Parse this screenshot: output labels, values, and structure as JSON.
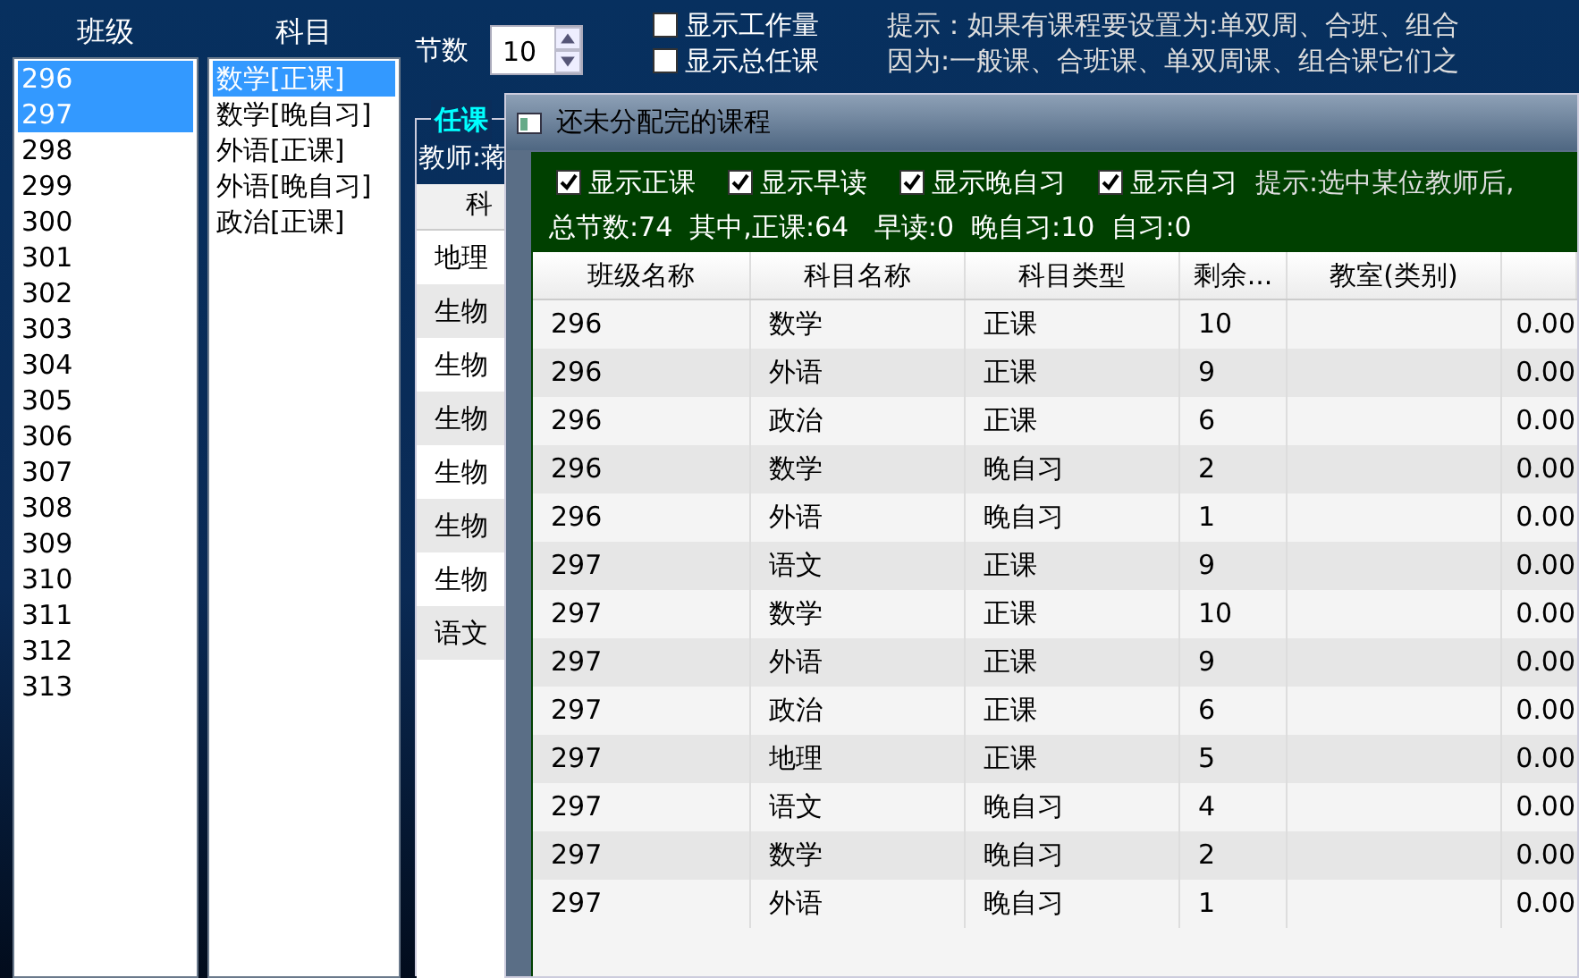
{
  "class_list": {
    "label": "班级",
    "items": [
      {
        "text": "296",
        "selected": true
      },
      {
        "text": "297",
        "selected": true
      },
      {
        "text": "298",
        "selected": false
      },
      {
        "text": "299",
        "selected": false
      },
      {
        "text": "300",
        "selected": false
      },
      {
        "text": "301",
        "selected": false
      },
      {
        "text": "302",
        "selected": false
      },
      {
        "text": "303",
        "selected": false
      },
      {
        "text": "304",
        "selected": false
      },
      {
        "text": "305",
        "selected": false
      },
      {
        "text": "306",
        "selected": false
      },
      {
        "text": "307",
        "selected": false
      },
      {
        "text": "308",
        "selected": false
      },
      {
        "text": "309",
        "selected": false
      },
      {
        "text": "310",
        "selected": false
      },
      {
        "text": "311",
        "selected": false
      },
      {
        "text": "312",
        "selected": false
      },
      {
        "text": "313",
        "selected": false
      }
    ]
  },
  "subject_list": {
    "label": "科目",
    "items": [
      {
        "text": "数学[正课]",
        "selected": true
      },
      {
        "text": "数学[晚自习]",
        "selected": false
      },
      {
        "text": "外语[正课]",
        "selected": false
      },
      {
        "text": "外语[晚自习]",
        "selected": false
      },
      {
        "text": "政治[正课]",
        "selected": false
      }
    ]
  },
  "period_count": {
    "label": "节数",
    "value": "10"
  },
  "options": [
    {
      "label": "显示工作量",
      "checked": false
    },
    {
      "label": "显示总任课",
      "checked": false
    }
  ],
  "hint_lines": [
    "提示：如果有课程要设置为:单双周、合班、组合",
    "因为:一般课、合班课、单双周课、组合课它们之"
  ],
  "assignment_panel": {
    "legend": "任课",
    "teacher": "教师:蒋",
    "columns": [
      "科"
    ],
    "rows": [
      "地理",
      "生物",
      "生物",
      "生物",
      "生物",
      "生物",
      "生物",
      "语文"
    ]
  },
  "dialog": {
    "title": "还未分配完的课程",
    "filters": [
      {
        "label": "显示正课",
        "checked": true
      },
      {
        "label": "显示早读",
        "checked": true
      },
      {
        "label": "显示晚自习",
        "checked": true
      },
      {
        "label": "显示自习",
        "checked": true
      }
    ],
    "hint": "提示:选中某位教师后,",
    "summary": "总节数:74  其中,正课:64   早读:0  晚自习:10  自习:0",
    "table": {
      "columns": [
        "班级名称",
        "科目名称",
        "科目类型",
        "剩余...",
        "教室(类别)"
      ],
      "rows": [
        {
          "class": "296",
          "subject": "数学",
          "type": "正课",
          "remaining": "10",
          "column_6": "0.00"
        },
        {
          "class": "296",
          "subject": "外语",
          "type": "正课",
          "remaining": "9",
          "column_6": "0.00"
        },
        {
          "class": "296",
          "subject": "政治",
          "type": "正课",
          "remaining": "6",
          "column_6": "0.00"
        },
        {
          "class": "296",
          "subject": "数学",
          "type": "晚自习",
          "remaining": "2",
          "column_6": "0.00"
        },
        {
          "class": "296",
          "subject": "外语",
          "type": "晚自习",
          "remaining": "1",
          "column_6": "0.00"
        },
        {
          "class": "297",
          "subject": "语文",
          "type": "正课",
          "remaining": "9",
          "column_6": "0.00"
        },
        {
          "class": "297",
          "subject": "数学",
          "type": "正课",
          "remaining": "10",
          "column_6": "0.00"
        },
        {
          "class": "297",
          "subject": "外语",
          "type": "正课",
          "remaining": "9",
          "column_6": "0.00"
        },
        {
          "class": "297",
          "subject": "政治",
          "type": "正课",
          "remaining": "6",
          "column_6": "0.00"
        },
        {
          "class": "297",
          "subject": "地理",
          "type": "正课",
          "remaining": "5",
          "column_6": "0.00"
        },
        {
          "class": "297",
          "subject": "语文",
          "type": "晚自习",
          "remaining": "4",
          "column_6": "0.00"
        },
        {
          "class": "297",
          "subject": "数学",
          "type": "晚自习",
          "remaining": "2",
          "column_6": "0.00"
        },
        {
          "class": "297",
          "subject": "外语",
          "type": "晚自习",
          "remaining": "1",
          "column_6": "0.00"
        }
      ]
    }
  }
}
